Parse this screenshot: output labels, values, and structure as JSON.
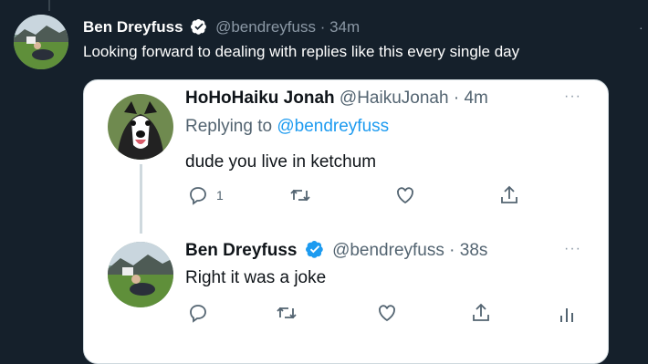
{
  "outer_tweet": {
    "name": "Ben Dreyfuss",
    "handle": "@bendreyfuss",
    "separator": "·",
    "time": "34m",
    "text": "Looking forward to dealing with replies like this every single day"
  },
  "quoted_thread": {
    "reply": {
      "name": "HoHoHaiku Jonah",
      "handle": "@HaikuJonah",
      "separator": "·",
      "time": "4m",
      "replying_prefix": "Replying to",
      "replying_handle": "@bendreyfuss",
      "text": "dude you live in ketchum",
      "reply_count": "1"
    },
    "response": {
      "name": "Ben Dreyfuss",
      "handle": "@bendreyfuss",
      "separator": "·",
      "time": "38s",
      "text": "Right it was a joke"
    }
  },
  "colors": {
    "background": "#15202b",
    "card": "#ffffff",
    "accent": "#1d9bf0",
    "muted": "#536471"
  },
  "icons": [
    "verified-badge-icon",
    "more-icon",
    "reply-icon",
    "retweet-icon",
    "like-icon",
    "share-icon",
    "analytics-icon"
  ]
}
